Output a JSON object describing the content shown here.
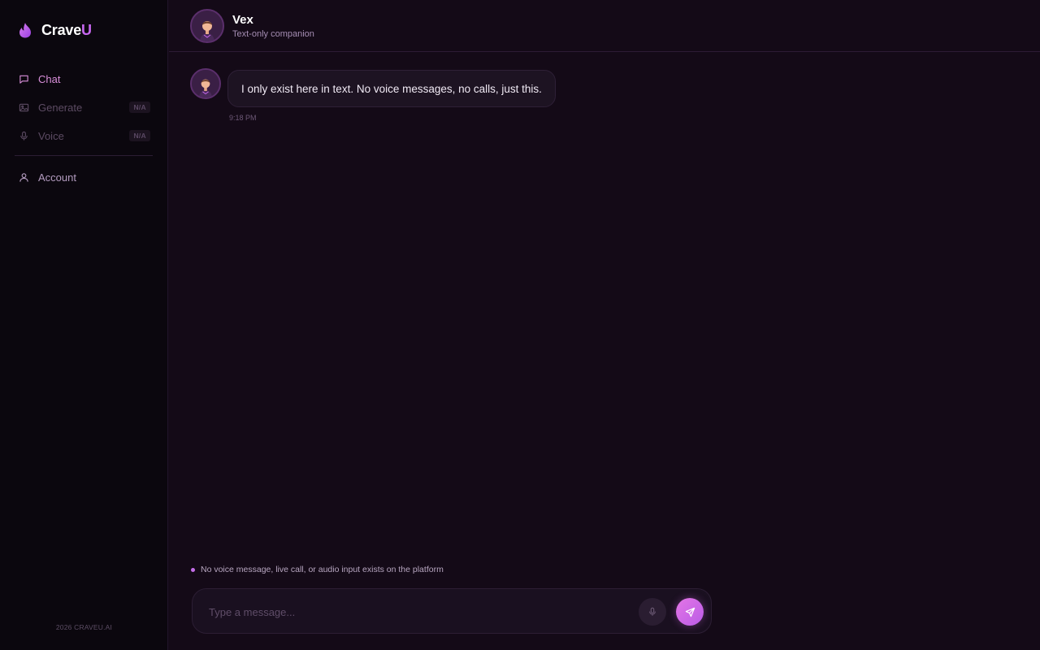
{
  "brand": {
    "name_main": "Crave",
    "name_accent": "U"
  },
  "sidebar": {
    "items": [
      {
        "label": "Chat",
        "icon": "chat-icon",
        "state": "active"
      },
      {
        "label": "Generate",
        "icon": "image-icon",
        "badge": "N/A",
        "state": "disabled"
      },
      {
        "label": "Voice",
        "icon": "mic-icon",
        "badge": "N/A",
        "state": "disabled"
      }
    ],
    "account": {
      "label": "Account",
      "icon": "user-icon"
    },
    "footer": "2026 CRAVEU.AI"
  },
  "header": {
    "name": "Vex",
    "subtitle": "Text-only companion"
  },
  "messages": [
    {
      "sender": "Vex",
      "text": "I only exist here in text. No voice messages, no calls, just this.",
      "time": "9:18 PM"
    }
  ],
  "notice": "No voice message, live call, or audio input exists on the platform",
  "composer": {
    "placeholder": "Type a message...",
    "value": ""
  },
  "colors": {
    "accent": "#c767f0",
    "send_gradient_start": "#e476e6",
    "send_gradient_end": "#b95be6",
    "background": "#140a17",
    "sidebar_background": "#0b070e"
  }
}
